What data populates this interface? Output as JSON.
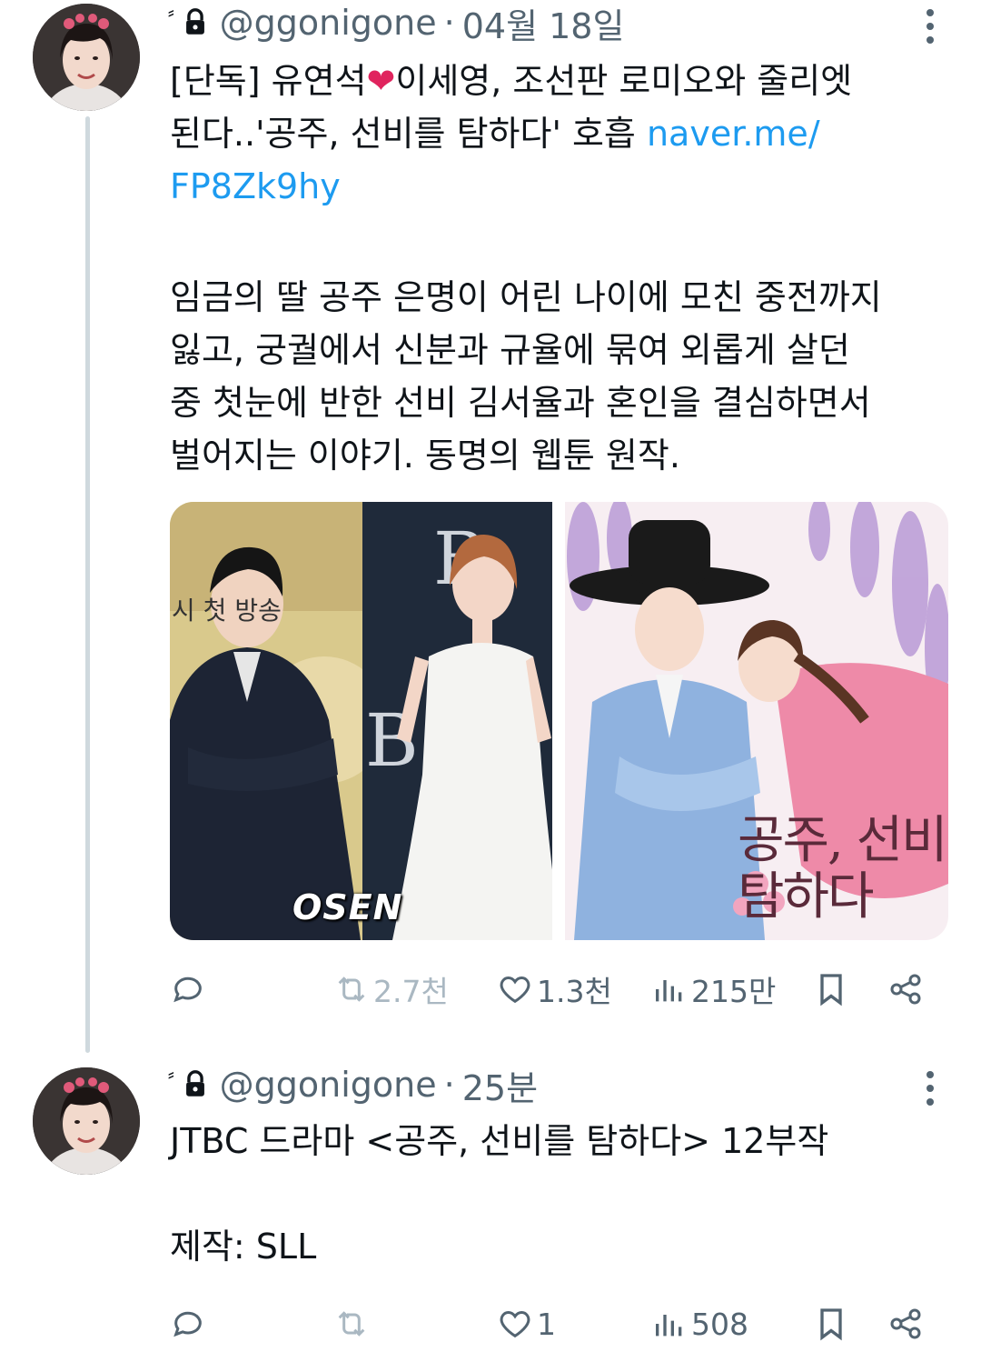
{
  "tweets": [
    {
      "handle": "@ggonigone",
      "dot": "·",
      "time": "04월 18일",
      "text_pre": "[단독] 유연석",
      "heart": "❤",
      "text_mid": "이세영, 조선판 로미오와 줄리엣\n된다..'공주, 선비를 탐하다' 호흡 ",
      "link1": "naver.me/",
      "link2": "FP8Zk9hy",
      "body": "임금의 딸 공주 은명이 어린 나이에 모친 중전까지\n잃고, 궁궐에서 신분과 규율에 묶여 외롭게 살던\n중 첫눈에 반한 선비 김서율과 혼인을 결심하면서\n벌어지는 이야기. 동명의 웹툰 원작.",
      "media": {
        "photo_watermark": "OSEN",
        "photo_sign": "시  첫 방송",
        "webtoon_title": "공주, 선비를\n탐하다"
      },
      "actions": {
        "retweets": "2.7천",
        "likes": "1.3천",
        "views": "215만"
      }
    },
    {
      "handle": "@ggonigone",
      "dot": "·",
      "time": "25분",
      "text": "JTBC 드라마 <공주, 선비를 탐하다> 12부작\n\n제작: SLL",
      "actions": {
        "retweets": "",
        "likes": "1",
        "views": "508"
      }
    }
  ],
  "icons": [
    "lock-icon",
    "more-icon",
    "reply-icon",
    "retweet-icon",
    "like-icon",
    "views-icon",
    "bookmark-icon",
    "share-icon"
  ],
  "colors": {
    "link": "#1d9bf0",
    "muted": "#536471",
    "heart": "#e0245e",
    "thread": "#cfd9de"
  }
}
